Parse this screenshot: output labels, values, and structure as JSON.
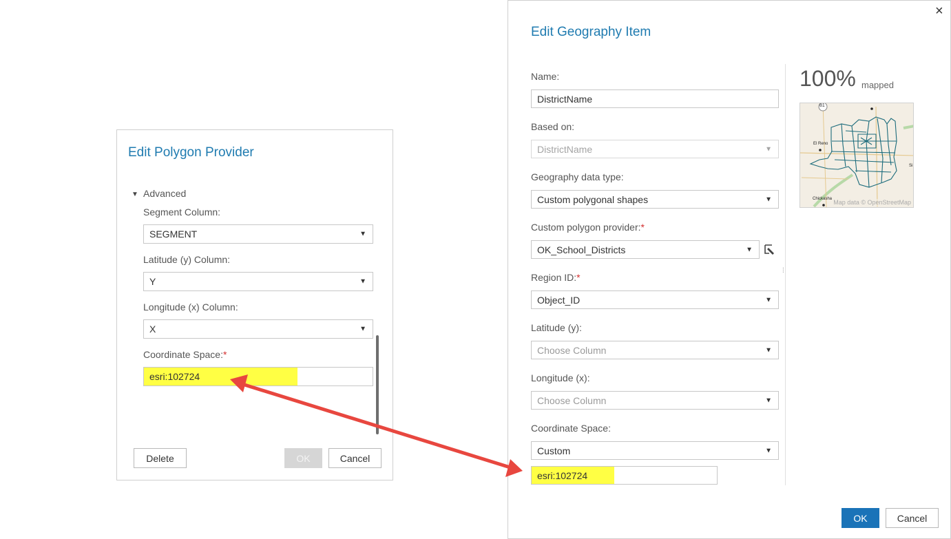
{
  "polygon_dialog": {
    "title": "Edit Polygon Provider",
    "section_label": "Advanced",
    "segment_label": "Segment Column:",
    "segment_value": "SEGMENT",
    "lat_label": "Latitude (y) Column:",
    "lat_value": "Y",
    "lon_label": "Longitude (x) Column:",
    "lon_value": "X",
    "coord_label": "Coordinate Space:",
    "coord_value": "esri:102724",
    "delete_label": "Delete",
    "ok_label": "OK",
    "cancel_label": "Cancel"
  },
  "geo_dialog": {
    "title": "Edit Geography Item",
    "close_icon": "×",
    "name_label": "Name:",
    "name_value": "DistrictName",
    "based_label": "Based on:",
    "based_value": "DistrictName",
    "type_label": "Geography data type:",
    "type_value": "Custom polygonal shapes",
    "provider_label": "Custom polygon provider:",
    "provider_value": "OK_School_Districts",
    "region_label": "Region ID:",
    "region_value": "Object_ID",
    "lat_label": "Latitude (y):",
    "lat_placeholder": "Choose Column",
    "lon_label": "Longitude (x):",
    "lon_placeholder": "Choose Column",
    "coord_label": "Coordinate Space:",
    "coord_value": "Custom",
    "coord_custom_value": "esri:102724",
    "mapped_percent": "100%",
    "mapped_word": "mapped",
    "map": {
      "highway_shield": "81",
      "city_1": "El Reno",
      "city_2": "Chickasha",
      "edge_label": "Si",
      "attribution": "Map data © OpenStreetMap"
    },
    "ok_label": "OK",
    "cancel_label": "Cancel"
  },
  "colors": {
    "accent": "#1f7bb0",
    "highlight": "#ffff44",
    "arrow": "#e8473f",
    "primary_button": "#1a73b8"
  }
}
